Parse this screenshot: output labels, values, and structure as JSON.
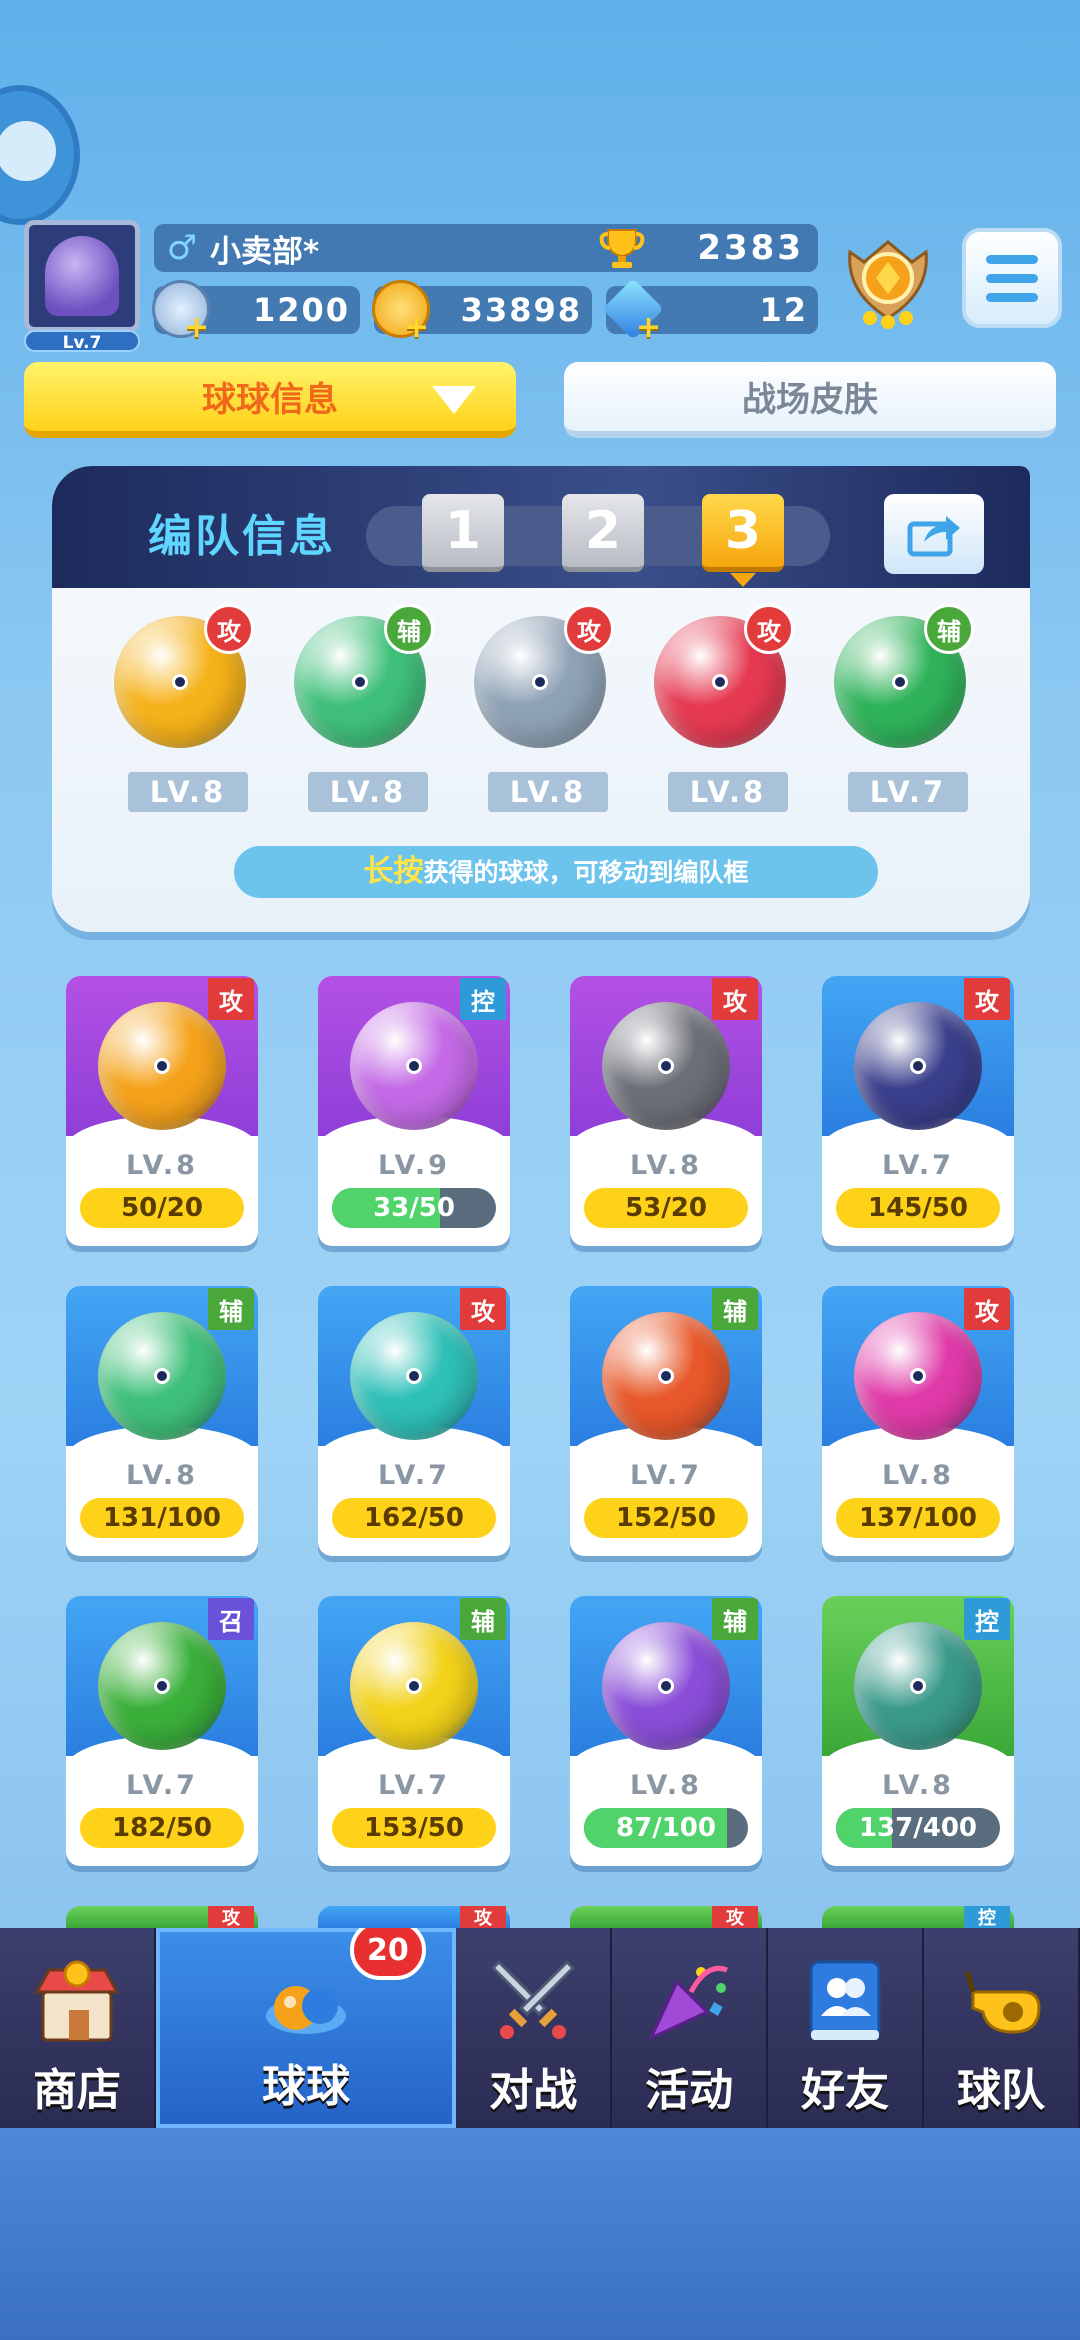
{
  "player": {
    "level": "Lv.7",
    "name": "小卖部*",
    "gender_icon": "male-icon",
    "trophies": "2383",
    "energy": "1200",
    "coins": "33898",
    "gems": "12"
  },
  "tabs": {
    "ball_info": "球球信息",
    "battle_skin": "战场皮肤"
  },
  "team": {
    "title": "编队信息",
    "slots": [
      "1",
      "2",
      "3"
    ],
    "active_slot": "3",
    "hint_highlight": "长按",
    "hint_rest": "获得的球球，可移动到编队框",
    "balls": [
      {
        "tag": "攻",
        "level": "LV.8",
        "color": "#f5b21a",
        "icon": "lightning-ball-icon"
      },
      {
        "tag": "辅",
        "level": "LV.8",
        "color": "#3fc07a",
        "icon": "sp-hands-ball-icon"
      },
      {
        "tag": "攻",
        "level": "LV.8",
        "color": "#8ea2b5",
        "icon": "vortex-ball-icon"
      },
      {
        "tag": "攻",
        "level": "LV.8",
        "color": "#e63a52",
        "icon": "fire-ball-icon"
      },
      {
        "tag": "辅",
        "level": "LV.7",
        "color": "#2fb35a",
        "icon": "star-arrow-ball-icon"
      }
    ]
  },
  "cards": [
    {
      "tag": "攻",
      "level": "LV.8",
      "progress": "50/20",
      "fill": 1,
      "bg": "purple",
      "orb": "#f5a21a"
    },
    {
      "tag": "控",
      "level": "LV.9",
      "progress": "33/50",
      "fill": 0.66,
      "bg": "purple",
      "orb": "#c46ae6"
    },
    {
      "tag": "攻",
      "level": "LV.8",
      "progress": "53/20",
      "fill": 1,
      "bg": "purple",
      "orb": "#6d6f78"
    },
    {
      "tag": "攻",
      "level": "LV.7",
      "progress": "145/50",
      "fill": 1,
      "bg": "blue",
      "orb": "#3a3f8c"
    },
    {
      "tag": "辅",
      "level": "LV.8",
      "progress": "131/100",
      "fill": 1,
      "bg": "blue",
      "orb": "#3fc07a"
    },
    {
      "tag": "攻",
      "level": "LV.7",
      "progress": "162/50",
      "fill": 1,
      "bg": "blue",
      "orb": "#2fc0b8"
    },
    {
      "tag": "辅",
      "level": "LV.7",
      "progress": "152/50",
      "fill": 1,
      "bg": "blue",
      "orb": "#e8582a"
    },
    {
      "tag": "攻",
      "level": "LV.8",
      "progress": "137/100",
      "fill": 1,
      "bg": "blue",
      "orb": "#e03aa8"
    },
    {
      "tag": "召",
      "level": "LV.7",
      "progress": "182/50",
      "fill": 1,
      "bg": "blue",
      "orb": "#3ab03a"
    },
    {
      "tag": "辅",
      "level": "LV.7",
      "progress": "153/50",
      "fill": 1,
      "bg": "blue",
      "orb": "#f2d21a"
    },
    {
      "tag": "辅",
      "level": "LV.8",
      "progress": "87/100",
      "fill": 0.87,
      "bg": "blue",
      "orb": "#8a4ed8"
    },
    {
      "tag": "控",
      "level": "LV.8",
      "progress": "137/400",
      "fill": 0.34,
      "bg": "green",
      "orb": "#3a9a8a"
    }
  ],
  "peek_tags": [
    "攻",
    "攻",
    "攻",
    "控"
  ],
  "nav": [
    {
      "label": "商店",
      "icon": "shop-icon"
    },
    {
      "label": "球球",
      "icon": "balls-icon",
      "badge": "20"
    },
    {
      "label": "对战",
      "icon": "crossed-swords-icon"
    },
    {
      "label": "活动",
      "icon": "party-popper-icon"
    },
    {
      "label": "好友",
      "icon": "friends-book-icon"
    },
    {
      "label": "球队",
      "icon": "whistle-icon"
    }
  ],
  "colors": {
    "attack": "#e23b3b",
    "support": "#4aa73a",
    "control": "#2f9ad8",
    "summon": "#6a52d8",
    "progress_full": "#ffd21a",
    "progress_partial": "#4fd36a"
  }
}
